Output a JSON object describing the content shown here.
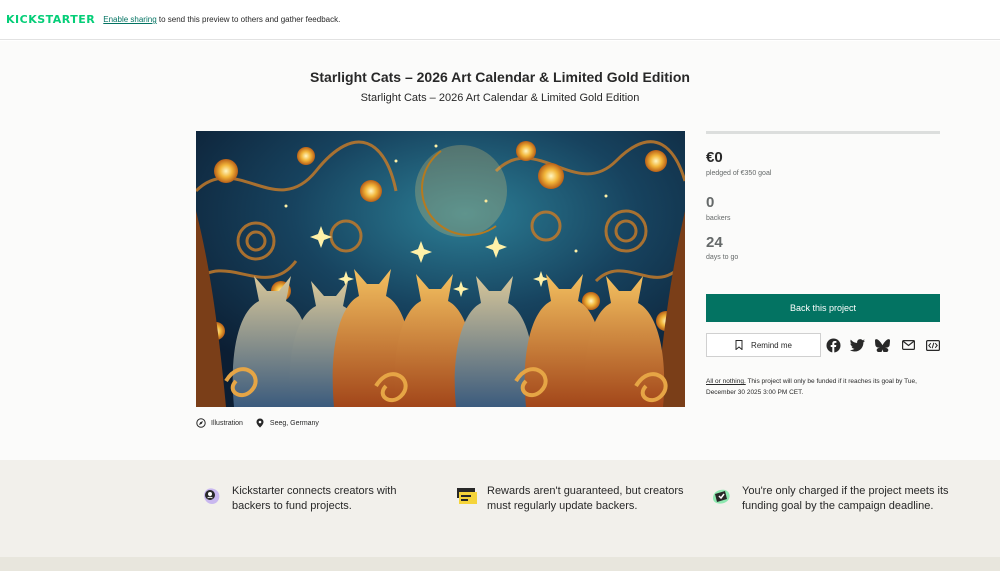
{
  "topbar": {
    "logo": "KICKSTARTER",
    "link": "Enable sharing",
    "message": " to send this preview to others and gather feedback."
  },
  "project": {
    "title": "Starlight Cats – 2026 Art Calendar & Limited Gold Edition",
    "subtitle": "Starlight Cats – 2026 Art Calendar & Limited Gold Edition",
    "category": "Illustration",
    "location": "Seeg, Germany"
  },
  "stats": {
    "funded_fraction": 0,
    "pledged": "€0",
    "pledged_label": "pledged of €350 goal",
    "backers": "0",
    "backers_label": "backers",
    "days": "24",
    "days_label": "days to go"
  },
  "actions": {
    "back_label": "Back this project",
    "remind_label": "Remind me"
  },
  "fineprint": {
    "bold": "All or nothing.",
    "text": " This project will only be funded if it reaches its goal by Tue, December 30 2025 3:00 PM CET."
  },
  "info": [
    {
      "text": "Kickstarter connects creators with backers to fund projects."
    },
    {
      "text": "Rewards aren't guaranteed, but creators must regularly update backers."
    },
    {
      "text": "You're only charged if the project meets its funding goal by the campaign deadline."
    }
  ],
  "colors": {
    "brand": "#05ce78",
    "accent": "#037362"
  }
}
